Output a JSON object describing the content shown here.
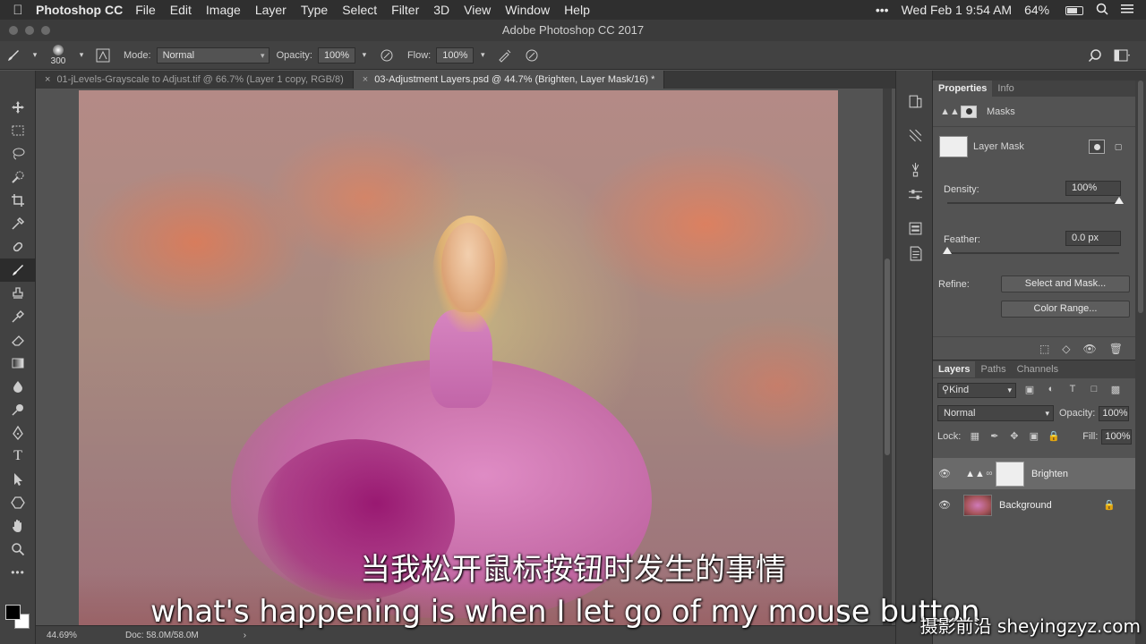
{
  "menubar": {
    "app_name": "Photoshop CC",
    "items": [
      "File",
      "Edit",
      "Image",
      "Layer",
      "Type",
      "Select",
      "Filter",
      "3D",
      "View",
      "Window",
      "Help"
    ],
    "more": "•••",
    "datetime": "Wed Feb 1  9:54 AM",
    "battery": "64%"
  },
  "window": {
    "title": "Adobe Photoshop CC 2017"
  },
  "options_bar": {
    "brush_size": "300",
    "mode_label": "Mode:",
    "mode_value": "Normal",
    "opacity_label": "Opacity:",
    "opacity_value": "100%",
    "flow_label": "Flow:",
    "flow_value": "100%"
  },
  "tabs": [
    {
      "label": "01-jLevels-Grayscale to Adjust.tif @ 66.7% (Layer 1 copy, RGB/8)",
      "active": false
    },
    {
      "label": "03-Adjustment Layers.psd @ 44.7% (Brighten, Layer Mask/16) *",
      "active": true
    }
  ],
  "status": {
    "zoom": "44.69%",
    "doc": "Doc: 58.0M/58.0M",
    "arrow": "›"
  },
  "properties": {
    "tabs": [
      "Properties",
      "Info"
    ],
    "section": "Masks",
    "mask_label": "Layer Mask",
    "density_label": "Density:",
    "density_value": "100%",
    "density_level": 1.0,
    "feather_label": "Feather:",
    "feather_value": "0.0 px",
    "feather_level": 0.0,
    "refine_label": "Refine:",
    "select_and_mask": "Select and Mask...",
    "color_range": "Color Range..."
  },
  "layers": {
    "tabs": [
      "Layers",
      "Paths",
      "Channels"
    ],
    "kind": "Kind",
    "blend_mode": "Normal",
    "opacity_label": "Opacity:",
    "opacity_value": "100%",
    "lock_label": "Lock:",
    "fill_label": "Fill:",
    "fill_value": "100%",
    "items": [
      {
        "name": "Brighten",
        "selected": true
      },
      {
        "name": "Background",
        "selected": false
      }
    ]
  },
  "subtitles": {
    "chinese": "当我松开鼠标按钮时发生的事情",
    "english": "what's happening is when I let go of my mouse button",
    "watermark": "摄影前沿 sheyingzyz.com"
  }
}
